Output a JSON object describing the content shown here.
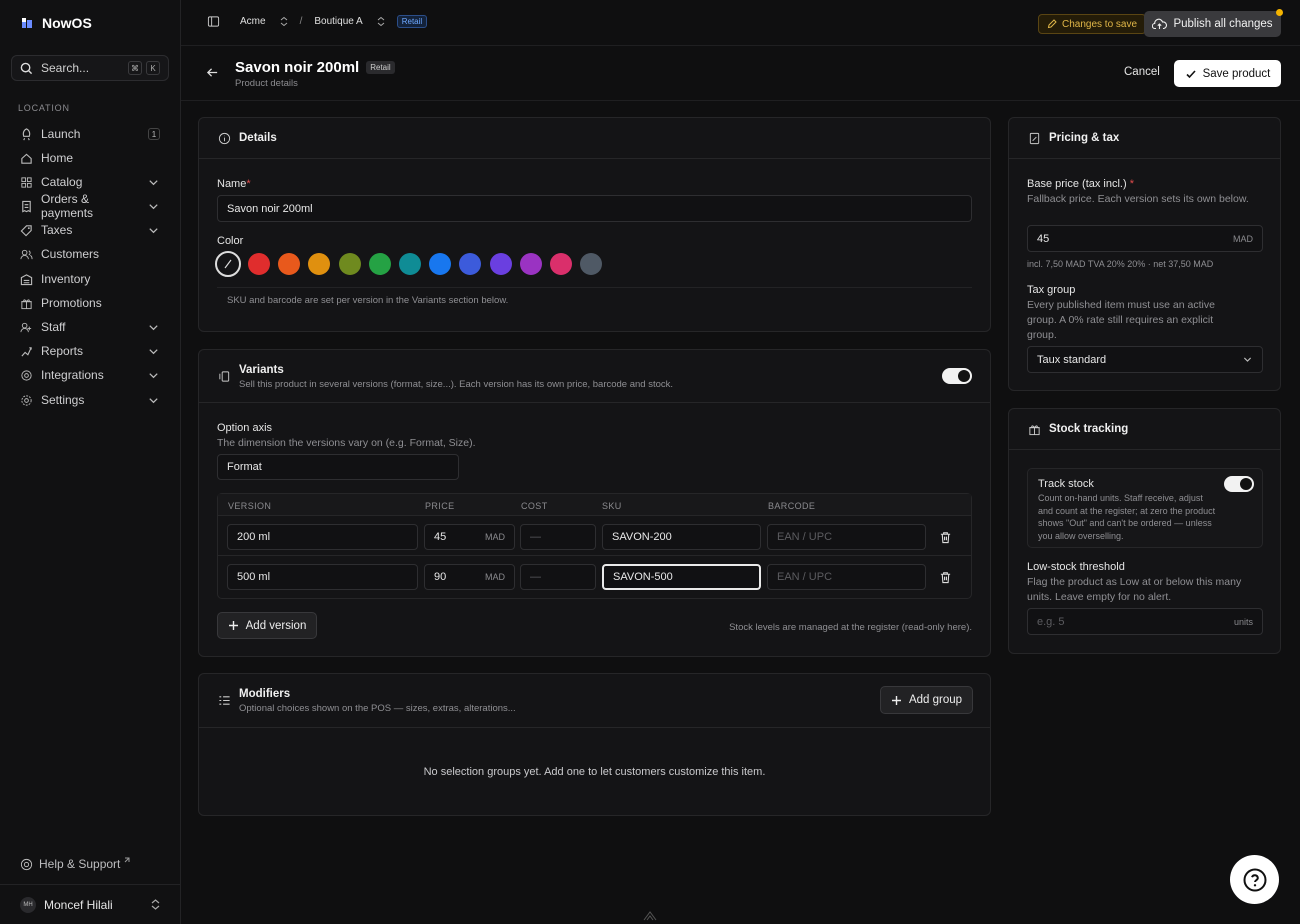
{
  "app": {
    "name": "NowOS"
  },
  "search": {
    "placeholder": "Search...",
    "kbd1": "⌘",
    "kbd2": "K"
  },
  "sidebar": {
    "section": "LOCATION",
    "items": [
      {
        "label": "Launch",
        "badge": "1"
      },
      {
        "label": "Home"
      },
      {
        "label": "Catalog"
      },
      {
        "label": "Orders & payments"
      },
      {
        "label": "Taxes"
      },
      {
        "label": "Customers"
      },
      {
        "label": "Inventory"
      },
      {
        "label": "Promotions"
      },
      {
        "label": "Staff"
      },
      {
        "label": "Reports"
      },
      {
        "label": "Integrations"
      },
      {
        "label": "Settings"
      }
    ],
    "help": "Help & Support",
    "user": {
      "initials": "MH",
      "name": "Moncef Hilali"
    }
  },
  "topbar": {
    "org": "Acme",
    "sep": "/",
    "store": "Boutique A",
    "tag": "Retail",
    "changes": "Changes to save",
    "publish": "Publish all changes"
  },
  "page": {
    "title": "Savon noir 200ml",
    "tag": "Retail",
    "subtitle": "Product details",
    "cancel": "Cancel",
    "save": "Save product"
  },
  "details": {
    "title": "Details",
    "name_label": "Name",
    "name_value": "Savon noir 200ml",
    "color_label": "Color",
    "colors": [
      "#e02d2d",
      "#e8591c",
      "#e0900f",
      "#6f8a1f",
      "#25a244",
      "#0f8c95",
      "#1877ef",
      "#3c5bdb",
      "#6a3fe0",
      "#9a33c2",
      "#da2f6b",
      "#4f5965"
    ],
    "note": "SKU and barcode are set per version in the Variants section below."
  },
  "variants": {
    "title": "Variants",
    "desc": "Sell this product in several versions (format, size...). Each version has its own price, barcode and stock.",
    "axis_label": "Option axis",
    "axis_hint": "The dimension the versions vary on (e.g. Format, Size).",
    "axis_value": "Format",
    "cols": {
      "version": "VERSION",
      "price": "PRICE",
      "cost": "COST",
      "sku": "SKU",
      "barcode": "BARCODE"
    },
    "rows": [
      {
        "version": "200 ml",
        "price": "45",
        "currency": "MAD",
        "cost": "—",
        "sku": "SAVON-200",
        "barcode": "EAN / UPC"
      },
      {
        "version": "500 ml",
        "price": "90",
        "currency": "MAD",
        "cost": "—",
        "sku": "SAVON-500",
        "barcode": "EAN / UPC"
      }
    ],
    "add": "Add version",
    "stock_note": "Stock levels are managed at the register (read-only here)."
  },
  "modifiers": {
    "title": "Modifiers",
    "desc": "Optional choices shown on the POS — sizes, extras, alterations...",
    "add": "Add group",
    "empty": "No selection groups yet. Add one to let customers customize this item."
  },
  "pricing": {
    "title": "Pricing & tax",
    "base_label": "Base price (tax incl.)",
    "base_hint": "Fallback price. Each version sets its own below.",
    "base_value": "45",
    "currency": "MAD",
    "breakdown": "incl. 7,50 MAD TVA 20% 20% · net 37,50 MAD",
    "taxgroup_label": "Tax group",
    "taxgroup_hint": "Every published item must use an active group. A 0% rate still requires an explicit group.",
    "taxgroup_value": "Taux standard"
  },
  "stock": {
    "title": "Stock tracking",
    "track_label": "Track stock",
    "track_hint": "Count on-hand units. Staff receive, adjust and count at the register; at zero the product shows \"Out\" and can't be ordered — unless you allow overselling.",
    "low_label": "Low-stock threshold",
    "low_hint": "Flag the product as Low at or below this many units. Leave empty for no alert.",
    "low_placeholder": "e.g. 5",
    "low_suffix": "units"
  }
}
